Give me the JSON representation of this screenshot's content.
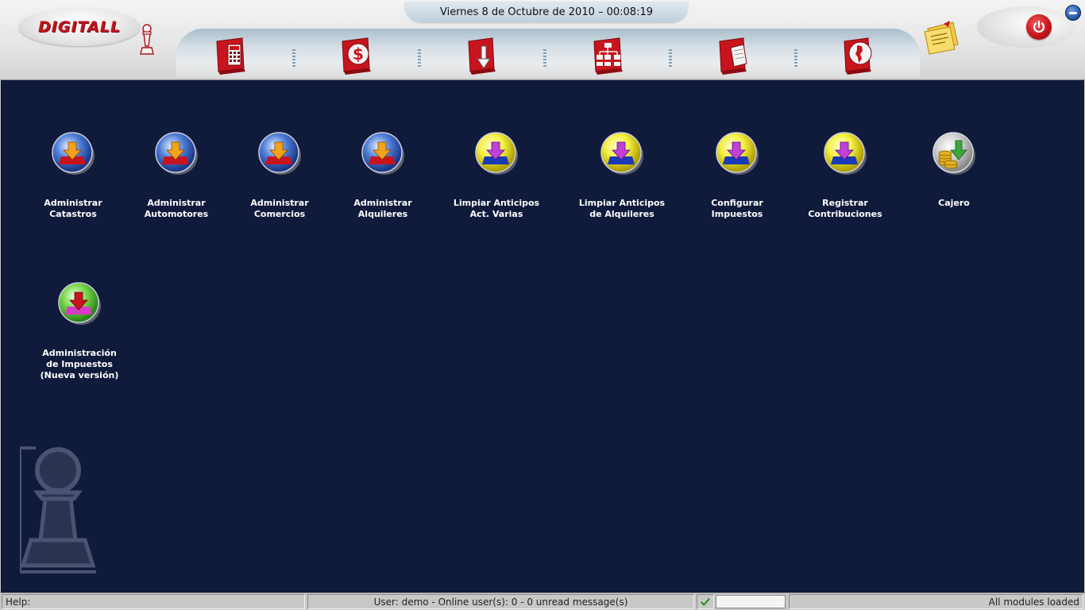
{
  "header": {
    "logo_text": "DIGITALL",
    "datetime": "Viernes 8 de Octubre de 2010 – 00:08:19",
    "toolbar": [
      {
        "id": "calculator",
        "icon": "calculator-book-icon"
      },
      {
        "id": "finance",
        "icon": "dollar-book-icon"
      },
      {
        "id": "import",
        "icon": "download-book-icon"
      },
      {
        "id": "structure",
        "icon": "org-chart-book-icon"
      },
      {
        "id": "documents",
        "icon": "documents-book-icon"
      },
      {
        "id": "map",
        "icon": "map-book-icon"
      }
    ]
  },
  "desktop": {
    "items": [
      {
        "label": "Administrar\nCatastros",
        "icon": "red-download-orb-icon"
      },
      {
        "label": "Administrar\nAutomotores",
        "icon": "red-download-orb-icon"
      },
      {
        "label": "Administrar\nComercios",
        "icon": "red-download-orb-icon"
      },
      {
        "label": "Administrar\nAlquileres",
        "icon": "red-download-orb-icon"
      },
      {
        "label": "Limpiar Anticipos\nAct. Varias",
        "icon": "blue-download-orb-icon"
      },
      {
        "label": "Limpiar Anticipos\nde Alquileres",
        "icon": "blue-download-orb-icon"
      },
      {
        "label": "Configurar\nImpuestos",
        "icon": "blue-download-orb-icon"
      },
      {
        "label": "Registrar\nContribuciones",
        "icon": "blue-download-orb-icon"
      },
      {
        "label": "Cajero",
        "icon": "coins-orb-icon"
      },
      {
        "label": "Administración\nde Impuestos\n(Nueva versión)",
        "icon": "green-download-orb-icon"
      }
    ]
  },
  "statusbar": {
    "help": "Help:",
    "user_info": "User: demo - Online user(s): 0 - 0 unread message(s)",
    "modules": "All modules loaded"
  },
  "colors": {
    "desktop_bg": "#101a3b",
    "accent_red": "#c8141c",
    "label_white": "#ffffff"
  }
}
